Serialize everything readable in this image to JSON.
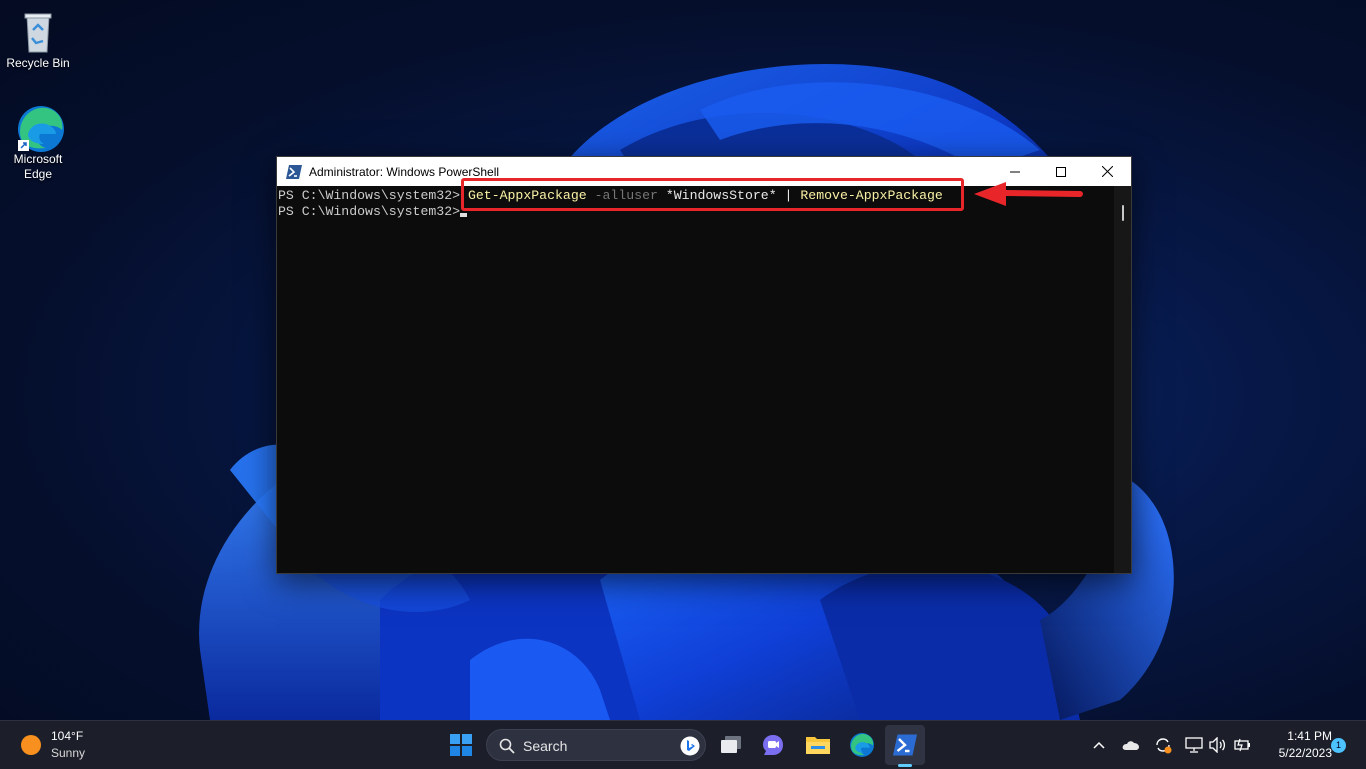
{
  "desktop": {
    "icons": [
      {
        "label": "Recycle Bin",
        "icon": "recycle-bin-icon"
      },
      {
        "label": "Microsoft\nEdge",
        "line1": "Microsoft",
        "line2": "Edge",
        "icon": "edge-icon"
      }
    ]
  },
  "window": {
    "title": "Administrator: Windows PowerShell",
    "icon": "powershell-icon",
    "controls": [
      "minimize-icon",
      "maximize-icon",
      "close-icon"
    ]
  },
  "console": {
    "line1": {
      "prompt": "PS C:\\Windows\\system32>",
      "cmd1": "Get-AppxPackage",
      "param": "-alluser",
      "arg": "*WindowsStore*",
      "pipe": "|",
      "cmd2": "Remove-AppxPackage"
    },
    "line2": {
      "prompt": "PS C:\\Windows\\system32>"
    }
  },
  "annotation": {
    "highlight_color": "#e8262a"
  },
  "taskbar": {
    "weather": {
      "temp": "104°F",
      "desc": "Sunny",
      "icon": "sun-icon"
    },
    "search_label": "Search",
    "apps": [
      "start-icon",
      "search-icon",
      "bing-icon",
      "task-view-icon",
      "chat-icon",
      "file-explorer-icon",
      "edge-icon",
      "powershell-icon"
    ],
    "tray": [
      "chevron-up-icon",
      "onedrive-icon",
      "update-icon",
      "network-icon",
      "volume-icon",
      "battery-icon"
    ],
    "time": "1:41 PM",
    "date": "5/22/2023",
    "notification_count": "1"
  },
  "colors": {
    "accent": "#60cdff",
    "console_bg": "#0c0c0c",
    "command_yellow": "#f9f1a5"
  }
}
